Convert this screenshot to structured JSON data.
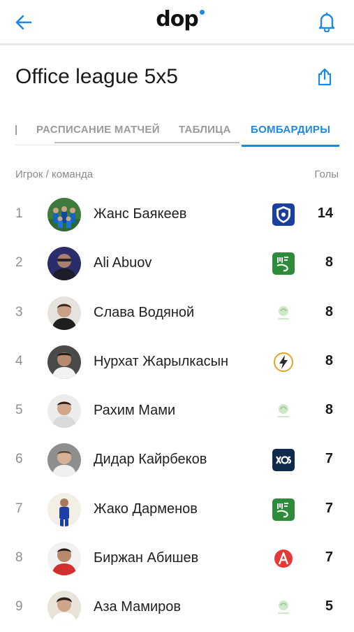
{
  "app": {
    "logo_text": "dop",
    "accent": "#1e88e5"
  },
  "header": {
    "title": "Office league 5x5"
  },
  "tabs": [
    {
      "label": "РАСПИСАНИЕ МАТЧЕЙ",
      "active": false
    },
    {
      "label": "ТАБЛИЦА",
      "active": false
    },
    {
      "label": "БОМБАРДИРЫ",
      "active": true
    }
  ],
  "table": {
    "col_player": "Игрок / команда",
    "col_goals": "Голы",
    "rows": [
      {
        "rank": "1",
        "name": "Жанс Баякеев",
        "goals": "14",
        "team_icon": "shield-crest-icon",
        "avatar": "team-photo"
      },
      {
        "rank": "2",
        "name": "Ali Abuov",
        "goals": "8",
        "team_icon": "green-bird-icon",
        "avatar": "dark-blue"
      },
      {
        "rank": "3",
        "name": "Слава Водяной",
        "goals": "8",
        "team_icon": "pale-green-logo-icon",
        "avatar": "light"
      },
      {
        "rank": "4",
        "name": "Нурхат Жарылкасын",
        "goals": "8",
        "team_icon": "lightning-icon",
        "avatar": "dark"
      },
      {
        "rank": "5",
        "name": "Рахим Мами",
        "goals": "8",
        "team_icon": "pale-green-logo-icon",
        "avatar": "light"
      },
      {
        "rank": "6",
        "name": "Дидар Кайрбеков",
        "goals": "7",
        "team_icon": "navy-xo-icon",
        "avatar": "gray"
      },
      {
        "rank": "7",
        "name": "Жако Дарменов",
        "goals": "7",
        "team_icon": "green-bird-icon",
        "avatar": "blue-kit"
      },
      {
        "rank": "8",
        "name": "Биржан Абишев",
        "goals": "7",
        "team_icon": "red-a-icon",
        "avatar": "red-kit"
      },
      {
        "rank": "9",
        "name": "Аза Мамиров",
        "goals": "5",
        "team_icon": "pale-green-logo-icon",
        "avatar": "light"
      }
    ]
  }
}
